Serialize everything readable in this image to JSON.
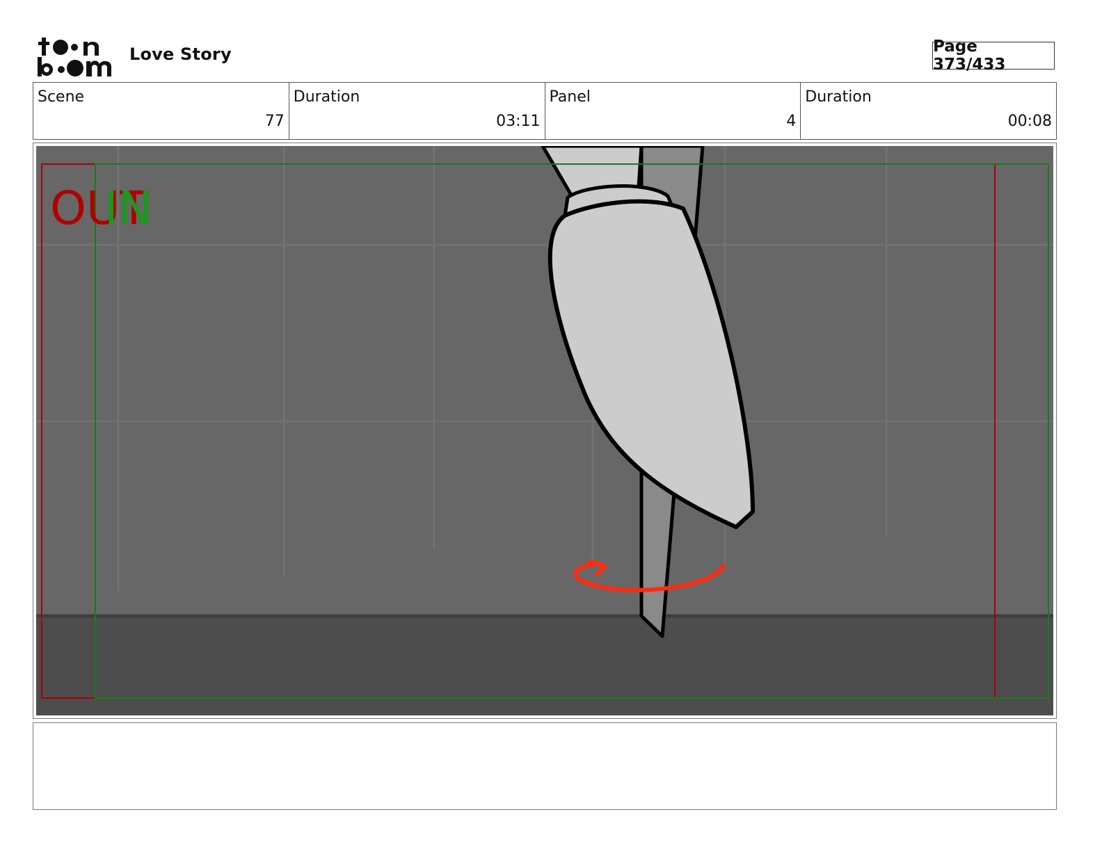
{
  "header": {
    "logo_name": "toon-boom-logo",
    "project_title": "Love Story",
    "page_label": "Page 373/433"
  },
  "info": {
    "scene_label": "Scene",
    "scene_value": "77",
    "scene_duration_label": "Duration",
    "scene_duration_value": "03:11",
    "panel_label": "Panel",
    "panel_value": "4",
    "panel_duration_label": "Duration",
    "panel_duration_value": "00:08"
  },
  "panel": {
    "out_label": "OUT",
    "in_label": "IN",
    "out_color": "#b00000",
    "in_color": "#1a9a1a",
    "arrow_color": "#ff2a10",
    "wall_color": "#676767",
    "floor_color": "#4d4d4d",
    "bottle_fill": "#cccccc"
  },
  "notes": {
    "text": ""
  }
}
